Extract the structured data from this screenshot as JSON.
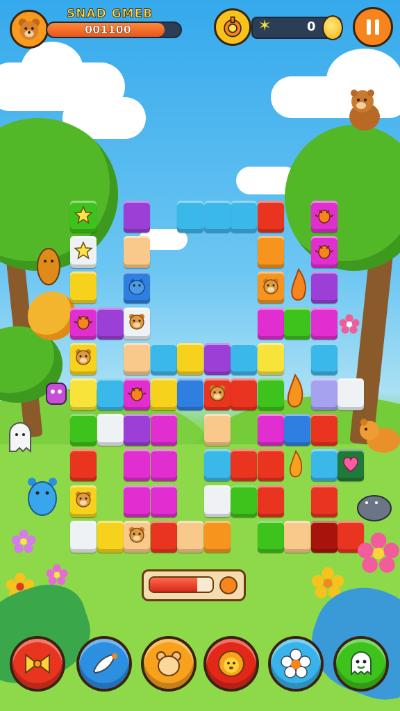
{
  "hud": {
    "title": "SNAD GMEB",
    "score": "001100",
    "coins": "0",
    "star_glyph": "✶"
  },
  "colors": {
    "green": "#3ec21c",
    "purple": "#9b3fd6",
    "magenta": "#e02ed0",
    "peach": "#f9c98c",
    "cyan": "#3bb8ea",
    "blue": "#2f7fe0",
    "red": "#e9341f",
    "orange": "#f7941d",
    "yellow": "#f7d21c",
    "lightyellow": "#f7e33a",
    "white": "#eef2f4",
    "lavender": "#a7a2f0",
    "lime": "#7ad11c",
    "darkred": "#a8140c",
    "darkgreen": "#1f7a3a",
    "pink": "#f75da0"
  },
  "board": {
    "tiles": [
      {
        "r": 0,
        "c": 0,
        "color": "green",
        "icon": "star-icon"
      },
      {
        "r": 0,
        "c": 2,
        "color": "purple"
      },
      {
        "r": 0,
        "c": 4,
        "color": "cyan"
      },
      {
        "r": 0,
        "c": 5,
        "color": "cyan"
      },
      {
        "r": 0,
        "c": 6,
        "color": "cyan"
      },
      {
        "r": 0,
        "c": 7,
        "color": "red"
      },
      {
        "r": 0,
        "c": 9,
        "color": "magenta",
        "icon": "bug-icon"
      },
      {
        "r": 1,
        "c": 0,
        "color": "white",
        "icon": "star-icon"
      },
      {
        "r": 1,
        "c": 2,
        "color": "peach"
      },
      {
        "r": 1,
        "c": 7,
        "color": "orange"
      },
      {
        "r": 1,
        "c": 9,
        "color": "magenta",
        "icon": "bug-icon"
      },
      {
        "r": 2,
        "c": 0,
        "color": "yellow"
      },
      {
        "r": 2,
        "c": 2,
        "color": "blue",
        "icon": "hippo-icon"
      },
      {
        "r": 2,
        "c": 7,
        "color": "orange",
        "icon": "bear-icon"
      },
      {
        "r": 2,
        "c": 9,
        "color": "purple"
      },
      {
        "r": 3,
        "c": 0,
        "color": "magenta",
        "icon": "bug-icon"
      },
      {
        "r": 3,
        "c": 1,
        "color": "purple"
      },
      {
        "r": 3,
        "c": 2,
        "color": "white",
        "icon": "bear-icon"
      },
      {
        "r": 3,
        "c": 7,
        "color": "magenta"
      },
      {
        "r": 3,
        "c": 8,
        "color": "green"
      },
      {
        "r": 3,
        "c": 9,
        "color": "magenta"
      },
      {
        "r": 4,
        "c": 0,
        "color": "yellow",
        "icon": "bear-icon"
      },
      {
        "r": 4,
        "c": 2,
        "color": "peach"
      },
      {
        "r": 4,
        "c": 3,
        "color": "cyan"
      },
      {
        "r": 4,
        "c": 4,
        "color": "yellow"
      },
      {
        "r": 4,
        "c": 5,
        "color": "purple"
      },
      {
        "r": 4,
        "c": 6,
        "color": "cyan"
      },
      {
        "r": 4,
        "c": 7,
        "color": "lightyellow"
      },
      {
        "r": 4,
        "c": 9,
        "color": "cyan"
      },
      {
        "r": 5,
        "c": 0,
        "color": "lightyellow"
      },
      {
        "r": 5,
        "c": 1,
        "color": "cyan"
      },
      {
        "r": 5,
        "c": 2,
        "color": "magenta",
        "icon": "bug-icon"
      },
      {
        "r": 5,
        "c": 3,
        "color": "yellow"
      },
      {
        "r": 5,
        "c": 4,
        "color": "blue"
      },
      {
        "r": 5,
        "c": 5,
        "color": "red",
        "icon": "bear-icon"
      },
      {
        "r": 5,
        "c": 6,
        "color": "red"
      },
      {
        "r": 5,
        "c": 7,
        "color": "green"
      },
      {
        "r": 5,
        "c": 9,
        "color": "lavender"
      },
      {
        "r": 5,
        "c": 10,
        "color": "white"
      },
      {
        "r": 6,
        "c": 0,
        "color": "green"
      },
      {
        "r": 6,
        "c": 1,
        "color": "white"
      },
      {
        "r": 6,
        "c": 2,
        "color": "purple"
      },
      {
        "r": 6,
        "c": 3,
        "color": "magenta"
      },
      {
        "r": 6,
        "c": 5,
        "color": "peach"
      },
      {
        "r": 6,
        "c": 7,
        "color": "magenta"
      },
      {
        "r": 6,
        "c": 8,
        "color": "blue"
      },
      {
        "r": 6,
        "c": 9,
        "color": "red"
      },
      {
        "r": 7,
        "c": 0,
        "color": "red"
      },
      {
        "r": 7,
        "c": 2,
        "color": "magenta"
      },
      {
        "r": 7,
        "c": 3,
        "color": "magenta"
      },
      {
        "r": 7,
        "c": 5,
        "color": "cyan"
      },
      {
        "r": 7,
        "c": 6,
        "color": "red"
      },
      {
        "r": 7,
        "c": 7,
        "color": "red"
      },
      {
        "r": 7,
        "c": 9,
        "color": "cyan"
      },
      {
        "r": 7,
        "c": 10,
        "color": "darkgreen",
        "icon": "heart-icon"
      },
      {
        "r": 8,
        "c": 0,
        "color": "yellow",
        "icon": "bear-icon"
      },
      {
        "r": 8,
        "c": 2,
        "color": "magenta"
      },
      {
        "r": 8,
        "c": 3,
        "color": "magenta"
      },
      {
        "r": 8,
        "c": 5,
        "color": "white"
      },
      {
        "r": 8,
        "c": 6,
        "color": "green"
      },
      {
        "r": 8,
        "c": 7,
        "color": "red"
      },
      {
        "r": 8,
        "c": 9,
        "color": "red"
      },
      {
        "r": 9,
        "c": 0,
        "color": "white"
      },
      {
        "r": 9,
        "c": 1,
        "color": "yellow"
      },
      {
        "r": 9,
        "c": 2,
        "color": "peach",
        "icon": "bear-icon"
      },
      {
        "r": 9,
        "c": 3,
        "color": "red"
      },
      {
        "r": 9,
        "c": 4,
        "color": "peach"
      },
      {
        "r": 9,
        "c": 5,
        "color": "orange"
      },
      {
        "r": 9,
        "c": 7,
        "color": "green"
      },
      {
        "r": 9,
        "c": 8,
        "color": "peach"
      },
      {
        "r": 9,
        "c": 9,
        "color": "darkred"
      },
      {
        "r": 9,
        "c": 10,
        "color": "red"
      }
    ]
  },
  "power_meter": {
    "level": 0.75
  },
  "bottom_bar": {
    "buttons": [
      {
        "name": "bow-button",
        "color": "#e9341f",
        "icon": "bow-icon"
      },
      {
        "name": "feather-button",
        "color": "#2d8fe0",
        "icon": "feather-icon"
      },
      {
        "name": "bear-head-button",
        "color": "#f7a11d",
        "icon": "bear-icon"
      },
      {
        "name": "lion-button",
        "color": "#e3281a",
        "icon": "lion-icon"
      },
      {
        "name": "flower-button",
        "color": "#39b3ec",
        "icon": "flower-icon"
      },
      {
        "name": "ghost-button",
        "color": "#3ec21c",
        "icon": "ghost-icon"
      }
    ]
  }
}
